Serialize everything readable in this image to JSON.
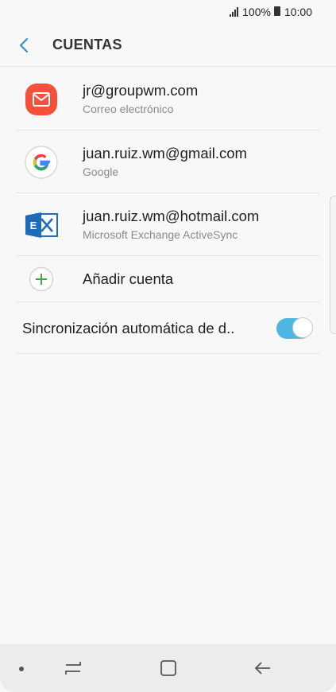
{
  "status_bar": {
    "battery_pct": "100%",
    "time": "10:00"
  },
  "header": {
    "title": "CUENTAS"
  },
  "accounts": [
    {
      "email": "jr@groupwm.com",
      "type": "Correo electrónico",
      "icon": "email-app-icon"
    },
    {
      "email": "juan.ruiz.wm@gmail.com",
      "type": "Google",
      "icon": "google-icon"
    },
    {
      "email": "juan.ruiz.wm@hotmail.com",
      "type": "Microsoft Exchange ActiveSync",
      "icon": "exchange-icon"
    }
  ],
  "add_account": {
    "label": "Añadir cuenta"
  },
  "auto_sync": {
    "label": "Sincronización automática de d..",
    "enabled": true
  },
  "colors": {
    "accent": "#4db6e2",
    "email_icon": "#f4513c",
    "add_green": "#3ea93e",
    "exchange_blue": "#1e6bb8"
  }
}
